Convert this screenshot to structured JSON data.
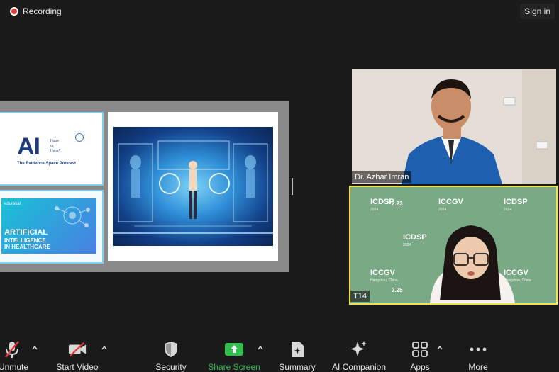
{
  "topbar": {
    "recording_label": "Recording",
    "signin_label": "Sign in"
  },
  "slides": {
    "tile1": {
      "logo": "AI",
      "hope_text": "Hope\nor\nHype?",
      "podcast": "The Evidence Space Podcast"
    },
    "tile2": {
      "brand": "edureka!",
      "title_line1": "ARTIFICIAL",
      "title_line2": "INTELLIGENCE\nIN HEALTHCARE"
    }
  },
  "participants": [
    {
      "name": "Dr. Azhar Imran"
    },
    {
      "name": "T14",
      "banners": [
        "ICDSP",
        "ICCGV",
        "ICDSP",
        "ICDSP",
        "ICCGV",
        "ICCGV"
      ],
      "banner_dates": [
        "2.23",
        "2.25"
      ],
      "banner_year": "2024",
      "banner_location": "Hangzhou, China"
    }
  ],
  "toolbar": {
    "unmute": "Unmute",
    "start_video": "Start Video",
    "security": "Security",
    "share_screen": "Share Screen",
    "summary": "Summary",
    "ai_companion": "AI Companion",
    "apps": "Apps",
    "more": "More"
  },
  "colors": {
    "share_green": "#2ebf4f",
    "speaker_border": "#f3e14a",
    "record_red": "#e0383e",
    "muted_red": "#e0383e"
  }
}
